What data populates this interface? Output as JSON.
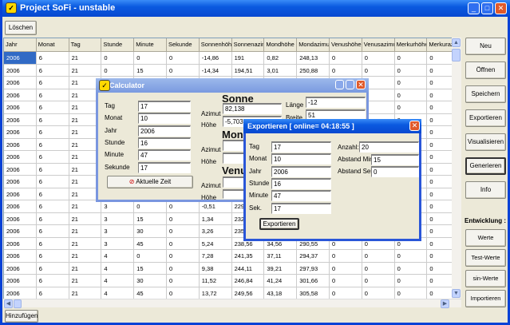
{
  "window": {
    "title": "Project SoFi  -  unstable",
    "icon": "sofi-app-icon"
  },
  "toolbar": {
    "clear_label": "Löschen",
    "add_label": "Hinzufügen"
  },
  "table": {
    "columns": [
      "Jahr",
      "Monat",
      "Tag",
      "Stunde",
      "Minute",
      "Sekunde",
      "Sonnenhöhe",
      "Sonnenazimut",
      "Mondhöhe",
      "Mondazimut",
      "Venushöhe",
      "Venusazimut",
      "Merkurhöhe",
      "Merkurazimut"
    ],
    "rows": [
      [
        "2006",
        "6",
        "21",
        "0",
        "0",
        "0",
        "-14,86",
        "191",
        "0,82",
        "248,13",
        "0",
        "0",
        "0",
        "0"
      ],
      [
        "2006",
        "6",
        "21",
        "0",
        "15",
        "0",
        "-14,34",
        "194,51",
        "3,01",
        "250,88",
        "0",
        "0",
        "0",
        "0"
      ],
      [
        "2006",
        "6",
        "21",
        "",
        "",
        "",
        "",
        "",
        "",
        "",
        "",
        "",
        "0",
        "0"
      ],
      [
        "2006",
        "6",
        "21",
        "",
        "",
        "",
        "",
        "",
        "",
        "",
        "",
        "",
        "0",
        "0"
      ],
      [
        "2006",
        "6",
        "21",
        "",
        "",
        "",
        "",
        "",
        "",
        "",
        "",
        "",
        "0",
        "0"
      ],
      [
        "2006",
        "6",
        "21",
        "",
        "",
        "",
        "",
        "",
        "",
        "",
        "",
        "",
        "0",
        "0"
      ],
      [
        "2006",
        "6",
        "21",
        "",
        "",
        "",
        "",
        "",
        "",
        "",
        "",
        "",
        "0",
        "0"
      ],
      [
        "2006",
        "6",
        "21",
        "",
        "",
        "",
        "",
        "",
        "",
        "",
        "",
        "",
        "0",
        "0"
      ],
      [
        "2006",
        "6",
        "21",
        "",
        "",
        "",
        "",
        "",
        "",
        "",
        "",
        "",
        "0",
        "0"
      ],
      [
        "2006",
        "6",
        "21",
        "",
        "",
        "",
        "",
        "",
        "",
        "",
        "",
        "",
        "0",
        "0"
      ],
      [
        "2006",
        "6",
        "21",
        "",
        "",
        "",
        "",
        "",
        "",
        "",
        "",
        "",
        "0",
        "0"
      ],
      [
        "2006",
        "6",
        "21",
        "",
        "",
        "",
        "",
        "",
        "",
        "",
        "",
        "",
        "0",
        "0"
      ],
      [
        "2006",
        "6",
        "21",
        "3",
        "0",
        "0",
        "-0,51",
        "229,5",
        "",
        "",
        "",
        "",
        "0",
        "0"
      ],
      [
        "2006",
        "6",
        "21",
        "3",
        "15",
        "0",
        "1,34",
        "232,6",
        "",
        "",
        "",
        "",
        "0",
        "0"
      ],
      [
        "2006",
        "6",
        "21",
        "3",
        "30",
        "0",
        "3,26",
        "235,7",
        "",
        "",
        "",
        "",
        "0",
        "0"
      ],
      [
        "2006",
        "6",
        "21",
        "3",
        "45",
        "0",
        "5,24",
        "238,56",
        "34,56",
        "290,55",
        "0",
        "0",
        "0",
        "0"
      ],
      [
        "2006",
        "6",
        "21",
        "4",
        "0",
        "0",
        "7,28",
        "241,35",
        "37,11",
        "294,37",
        "0",
        "0",
        "0",
        "0"
      ],
      [
        "2006",
        "6",
        "21",
        "4",
        "15",
        "0",
        "9,38",
        "244,11",
        "39,21",
        "297,93",
        "0",
        "0",
        "0",
        "0"
      ],
      [
        "2006",
        "6",
        "21",
        "4",
        "30",
        "0",
        "11,52",
        "246,84",
        "41,24",
        "301,66",
        "0",
        "0",
        "0",
        "0"
      ],
      [
        "2006",
        "6",
        "21",
        "4",
        "45",
        "0",
        "13,72",
        "249,56",
        "43,18",
        "305,58",
        "0",
        "0",
        "0",
        "0"
      ]
    ]
  },
  "side": {
    "buttons": [
      "Neu",
      "Öffnen",
      "Speichern",
      "Exportieren",
      "Visualisieren",
      "Generieren",
      "Info"
    ],
    "dev_label": "Entwicklung :",
    "dev_buttons": [
      "Werte zeichnen",
      "Test-Werte",
      "sin-Werte",
      "Importieren"
    ]
  },
  "calc": {
    "title": "Calculator",
    "fields": [
      {
        "label": "Tag",
        "value": "17"
      },
      {
        "label": "Monat",
        "value": "10"
      },
      {
        "label": "Jahr",
        "value": "2006"
      },
      {
        "label": "Stunde",
        "value": "16"
      },
      {
        "label": "Minute",
        "value": "47"
      },
      {
        "label": "Sekunde",
        "value": "17"
      }
    ],
    "now_button": "Aktuelle Zeit",
    "sun": {
      "heading": "Sonne",
      "azimut_label": "Azimut",
      "azimut": "82,138",
      "hoehe_label": "Höhe",
      "hoehe": "-5,703"
    },
    "moon": {
      "heading": "Mond",
      "azimut_label": "Azimut",
      "hoehe_label": "Höhe"
    },
    "venus": {
      "heading": "Venus",
      "azimut_label": "Azimut",
      "hoehe_label": "Höhe"
    },
    "laenge_label": "Länge",
    "laenge": "-12",
    "breite_label": "Breite",
    "breite": "51"
  },
  "export": {
    "title": "Exportieren    [  online= 04:18:55  ]",
    "fields": [
      {
        "label": "Tag",
        "value": "17"
      },
      {
        "label": "Monat",
        "value": "10"
      },
      {
        "label": "Jahr",
        "value": "2006"
      },
      {
        "label": "Stunde",
        "value": "16"
      },
      {
        "label": "Minute",
        "value": "47"
      },
      {
        "label": "Sek.",
        "value": "17"
      }
    ],
    "anzahl_label": "Anzahl:",
    "anzahl": "20",
    "min_label": "Abstand Min.",
    "min": "15",
    "sek_label": "Abstand Sek.",
    "sek": "0",
    "button": "Exportieren"
  }
}
